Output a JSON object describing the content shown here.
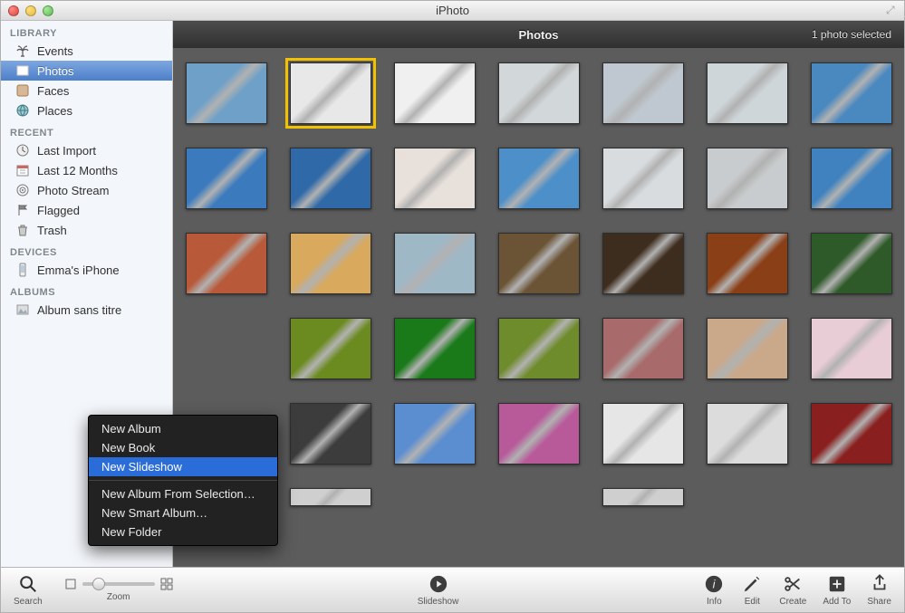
{
  "window": {
    "title": "iPhoto"
  },
  "header": {
    "title": "Photos",
    "status": "1 photo selected"
  },
  "sidebar": {
    "sections": [
      {
        "title": "LIBRARY",
        "items": [
          {
            "label": "Events",
            "icon": "palm"
          },
          {
            "label": "Photos",
            "icon": "photos",
            "selected": true
          },
          {
            "label": "Faces",
            "icon": "faces"
          },
          {
            "label": "Places",
            "icon": "globe"
          }
        ]
      },
      {
        "title": "RECENT",
        "items": [
          {
            "label": "Last Import",
            "icon": "clock"
          },
          {
            "label": "Last 12 Months",
            "icon": "calendar"
          },
          {
            "label": "Photo Stream",
            "icon": "stream"
          },
          {
            "label": "Flagged",
            "icon": "flag"
          },
          {
            "label": "Trash",
            "icon": "trash"
          }
        ]
      },
      {
        "title": "DEVICES",
        "items": [
          {
            "label": "Emma's iPhone",
            "icon": "phone"
          }
        ]
      },
      {
        "title": "ALBUMS",
        "items": [
          {
            "label": "Album sans titre",
            "icon": "album"
          }
        ]
      }
    ]
  },
  "thumbs": {
    "rows": 6,
    "cols": 7,
    "selected_index": 1,
    "items": [
      {
        "c": "#6ea0c8"
      },
      {
        "c": "#e8e8e8"
      },
      {
        "c": "#f0f0f0"
      },
      {
        "c": "#d2d7d9"
      },
      {
        "c": "#bfc8d0"
      },
      {
        "c": "#cfd6da"
      },
      {
        "c": "#4a88c0"
      },
      {
        "c": "#3b7bbd"
      },
      {
        "c": "#2f69a8"
      },
      {
        "c": "#e8e0da"
      },
      {
        "c": "#4d8fc9"
      },
      {
        "c": "#d8dcdf"
      },
      {
        "c": "#c9ccce"
      },
      {
        "c": "#3f82bf"
      },
      {
        "c": "#b85a3a"
      },
      {
        "c": "#d9a95d"
      },
      {
        "c": "#9fb8c6"
      },
      {
        "c": "#6b5436"
      },
      {
        "c": "#3d2d1e"
      },
      {
        "c": "#8a3f16"
      },
      {
        "c": "#2e5a2a"
      },
      {
        "hidden": true
      },
      {
        "c": "#6b8a1f"
      },
      {
        "c": "#1a7a1a"
      },
      {
        "c": "#6f8c2c"
      },
      {
        "c": "#a86a6a"
      },
      {
        "c": "#caa98a"
      },
      {
        "c": "#e8cdd6"
      },
      {
        "hidden": true
      },
      {
        "c": "#3c3c3c"
      },
      {
        "c": "#5a8ed0"
      },
      {
        "c": "#b85a9a"
      },
      {
        "c": "#e6e6e6"
      },
      {
        "c": "#dcdcdc"
      },
      {
        "c": "#8a1f1f"
      },
      {
        "hidden": true
      },
      {
        "c": "#cfcfcf",
        "partial": true
      },
      {
        "hidden": true
      },
      {
        "hidden": true
      },
      {
        "c": "#cfcfcf",
        "partial": true
      },
      {
        "hidden": true
      },
      {
        "hidden": true
      }
    ]
  },
  "context_menu": {
    "items": [
      {
        "label": "New Album"
      },
      {
        "label": "New Book"
      },
      {
        "label": "New Slideshow",
        "highlight": true
      },
      {
        "sep": true
      },
      {
        "label": "New Album From Selection…"
      },
      {
        "label": "New Smart Album…"
      },
      {
        "label": "New Folder"
      }
    ]
  },
  "toolbar": {
    "search": "Search",
    "zoom": "Zoom",
    "slideshow": "Slideshow",
    "info": "Info",
    "edit": "Edit",
    "create": "Create",
    "addto": "Add To",
    "share": "Share"
  }
}
